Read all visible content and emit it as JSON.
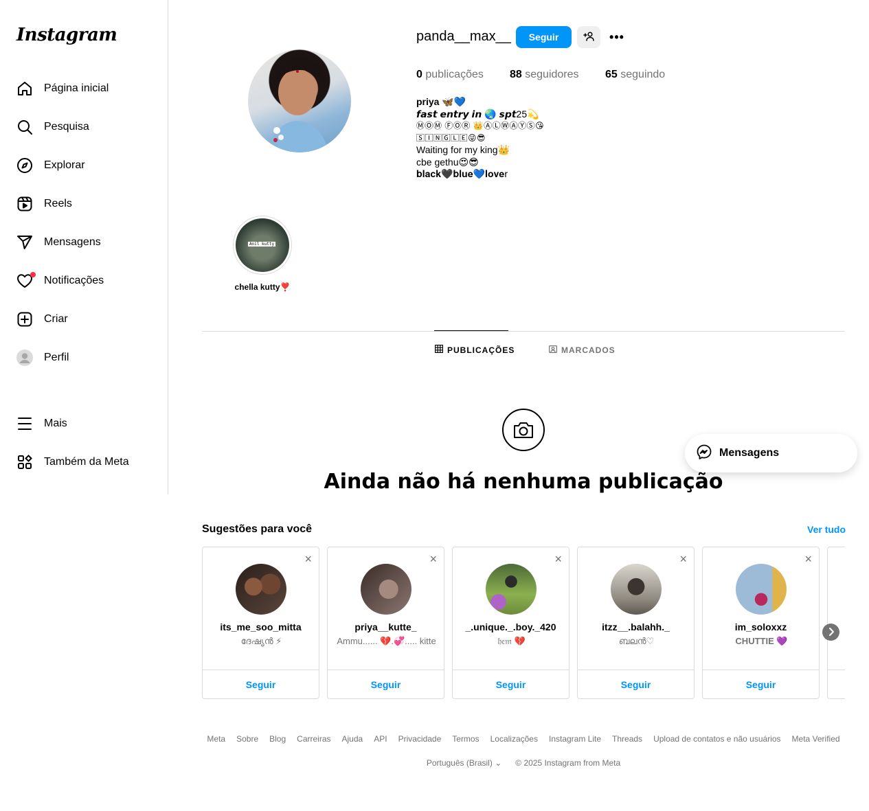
{
  "sidebar": {
    "logo": "Instagram",
    "items": [
      {
        "label": "Página inicial",
        "icon": "home-icon"
      },
      {
        "label": "Pesquisa",
        "icon": "search-icon"
      },
      {
        "label": "Explorar",
        "icon": "compass-icon"
      },
      {
        "label": "Reels",
        "icon": "reels-icon"
      },
      {
        "label": "Mensagens",
        "icon": "send-icon"
      },
      {
        "label": "Notificações",
        "icon": "heart-icon"
      },
      {
        "label": "Criar",
        "icon": "plus-square-icon"
      },
      {
        "label": "Perfil",
        "icon": "avatar-icon"
      }
    ],
    "more": "Mais",
    "meta": "Também da Meta"
  },
  "profile": {
    "username": "panda__max__",
    "follow_label": "Seguir",
    "stats": {
      "posts_count": "0",
      "posts_label": "publicações",
      "followers_count": "88",
      "followers_label": "seguidores",
      "following_count": "65",
      "following_label": "seguindo"
    },
    "bio": {
      "name": "priya 🦋💙",
      "line1": "𝙛𝙖𝙨𝙩 𝙚𝙣𝙩𝙧𝙮 𝙞𝙣 🌏 𝙨𝙥𝙩25💫",
      "line2": "ⓂⓄⓂ ⒻⓄⓇ 👑ⒶⓁⓌⒶⓎⓈ😘",
      "line3": "🅂🄸🄽🄶🄻🄴😜😎",
      "line4": "Waiting for my king👑",
      "line5": "cbe gethu😍😎",
      "line6": "𝐛𝐥𝐚𝐜𝐤🖤𝐛𝐥𝐮𝐞💙𝐥𝐨𝐯𝐞r"
    }
  },
  "highlight": {
    "label": "chella kutty❣️",
    "overlay_text": "Anil kutty"
  },
  "tabs": {
    "posts": "PUBLICAÇÕES",
    "tagged": "MARCADOS"
  },
  "empty": {
    "title": "Ainda não há nenhuma publicação"
  },
  "messages_float": "Mensagens",
  "suggestions": {
    "title": "Sugestões para você",
    "see_all": "Ver tudo",
    "follow_label": "Seguir",
    "cards": [
      {
        "username": "its_me_soo_mitta",
        "sub": "ദേഷ്യൻ ⚡"
      },
      {
        "username": "priya__kutte_",
        "sub": "Ammu...... 💔.💞..... kitte"
      },
      {
        "username": "_.unique._.boy._420",
        "sub": "𝔥𝔢𝔪 💔"
      },
      {
        "username": "itzz__.balahh._",
        "sub": "ബലൻ♡"
      },
      {
        "username": "im_soloxxz",
        "sub": "CHUTTIE 💜"
      }
    ]
  },
  "footer": {
    "links": [
      "Meta",
      "Sobre",
      "Blog",
      "Carreiras",
      "Ajuda",
      "API",
      "Privacidade",
      "Termos",
      "Localizações",
      "Instagram Lite",
      "Threads",
      "Upload de contatos e não usuários",
      "Meta Verified"
    ],
    "language": "Português (Brasil)",
    "copyright": "© 2025 Instagram from Meta"
  },
  "colors": {
    "accent": "#0095f6",
    "secondary_text": "#737373",
    "border": "#dbdbdb",
    "notification": "#ff3040"
  }
}
